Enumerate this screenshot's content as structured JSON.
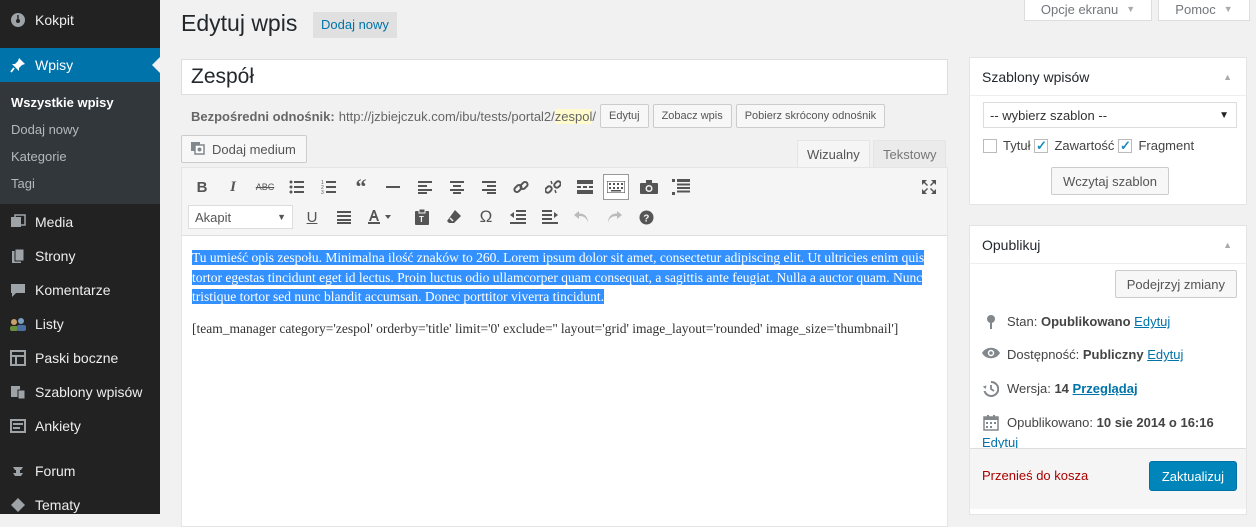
{
  "sidebar": {
    "items": [
      {
        "label": "Kokpit",
        "icon": "dashboard-icon"
      },
      {
        "label": "Wpisy",
        "icon": "pin-icon"
      },
      {
        "label": "Media",
        "icon": "media-icon"
      },
      {
        "label": "Strony",
        "icon": "pages-icon"
      },
      {
        "label": "Komentarze",
        "icon": "comments-icon"
      },
      {
        "label": "Listy",
        "icon": "users-group-icon"
      },
      {
        "label": "Paski boczne",
        "icon": "grid-icon"
      },
      {
        "label": "Szablony wpisów",
        "icon": "templates-icon"
      },
      {
        "label": "Ankiety",
        "icon": "poll-icon"
      },
      {
        "label": "Forum",
        "icon": "forum-icon"
      },
      {
        "label": "Tematy",
        "icon": "topics-icon"
      }
    ],
    "submenu": [
      "Wszystkie wpisy",
      "Dodaj nowy",
      "Kategorie",
      "Tagi"
    ]
  },
  "header": {
    "title": "Edytuj wpis",
    "add_new": "Dodaj nowy",
    "screen_options": "Opcje ekranu",
    "help": "Pomoc"
  },
  "post": {
    "title": "Zespół",
    "permalink_label": "Bezpośredni odnośnik:",
    "permalink_base": "http://jzbiejczuk.com/ibu/tests/portal2/",
    "permalink_slug": "zespol",
    "permalink_end": "/",
    "edit_btn": "Edytuj",
    "view_btn": "Zobacz wpis",
    "shortlink_btn": "Pobierz skrócony odnośnik"
  },
  "editor": {
    "add_media": "Dodaj medium",
    "tab_visual": "Wizualny",
    "tab_text": "Tekstowy",
    "format": "Akapit",
    "selected_text": "Tu umieść opis zespołu. Minimalna ilość znaków to 260. Lorem ipsum dolor sit amet, consectetur adipiscing elit. Ut ultricies enim quis tortor egestas tincidunt eget id lectus. Proin luctus odio ullamcorper quam consequat, a sagittis ante feugiat. Nulla a auctor quam. Nunc tristique tortor sed nunc blandit accumsan. Donec porttitor viverra tincidunt.",
    "shortcode": "[team_manager category='zespol' orderby='title' limit='0' exclude='' layout='grid' image_layout='rounded' image_size='thumbnail']"
  },
  "templates_box": {
    "title": "Szablony wpisów",
    "select_value": "-- wybierz szablon --",
    "opt_title": "Tytuł",
    "opt_content": "Zawartość",
    "opt_excerpt": "Fragment",
    "load_btn": "Wczytaj szablon"
  },
  "publish_box": {
    "title": "Opublikuj",
    "preview_btn": "Podejrzyj zmiany",
    "status_label": "Stan:",
    "status_value": "Opublikowano",
    "visibility_label": "Dostępność:",
    "visibility_value": "Publiczny",
    "revisions_label": "Wersja:",
    "revisions_value": "14",
    "browse_link": "Przeglądaj",
    "published_label": "Opublikowano:",
    "published_value": "10 sie 2014 o 16:16",
    "edit_link": "Edytuj",
    "trash_link": "Przenieś do kosza",
    "update_btn": "Zaktualizuj"
  },
  "colors": {
    "sidebar_bg": "#222222",
    "accent": "#0073aa",
    "primary_button": "#0085ba",
    "selection": "#3390ff"
  }
}
